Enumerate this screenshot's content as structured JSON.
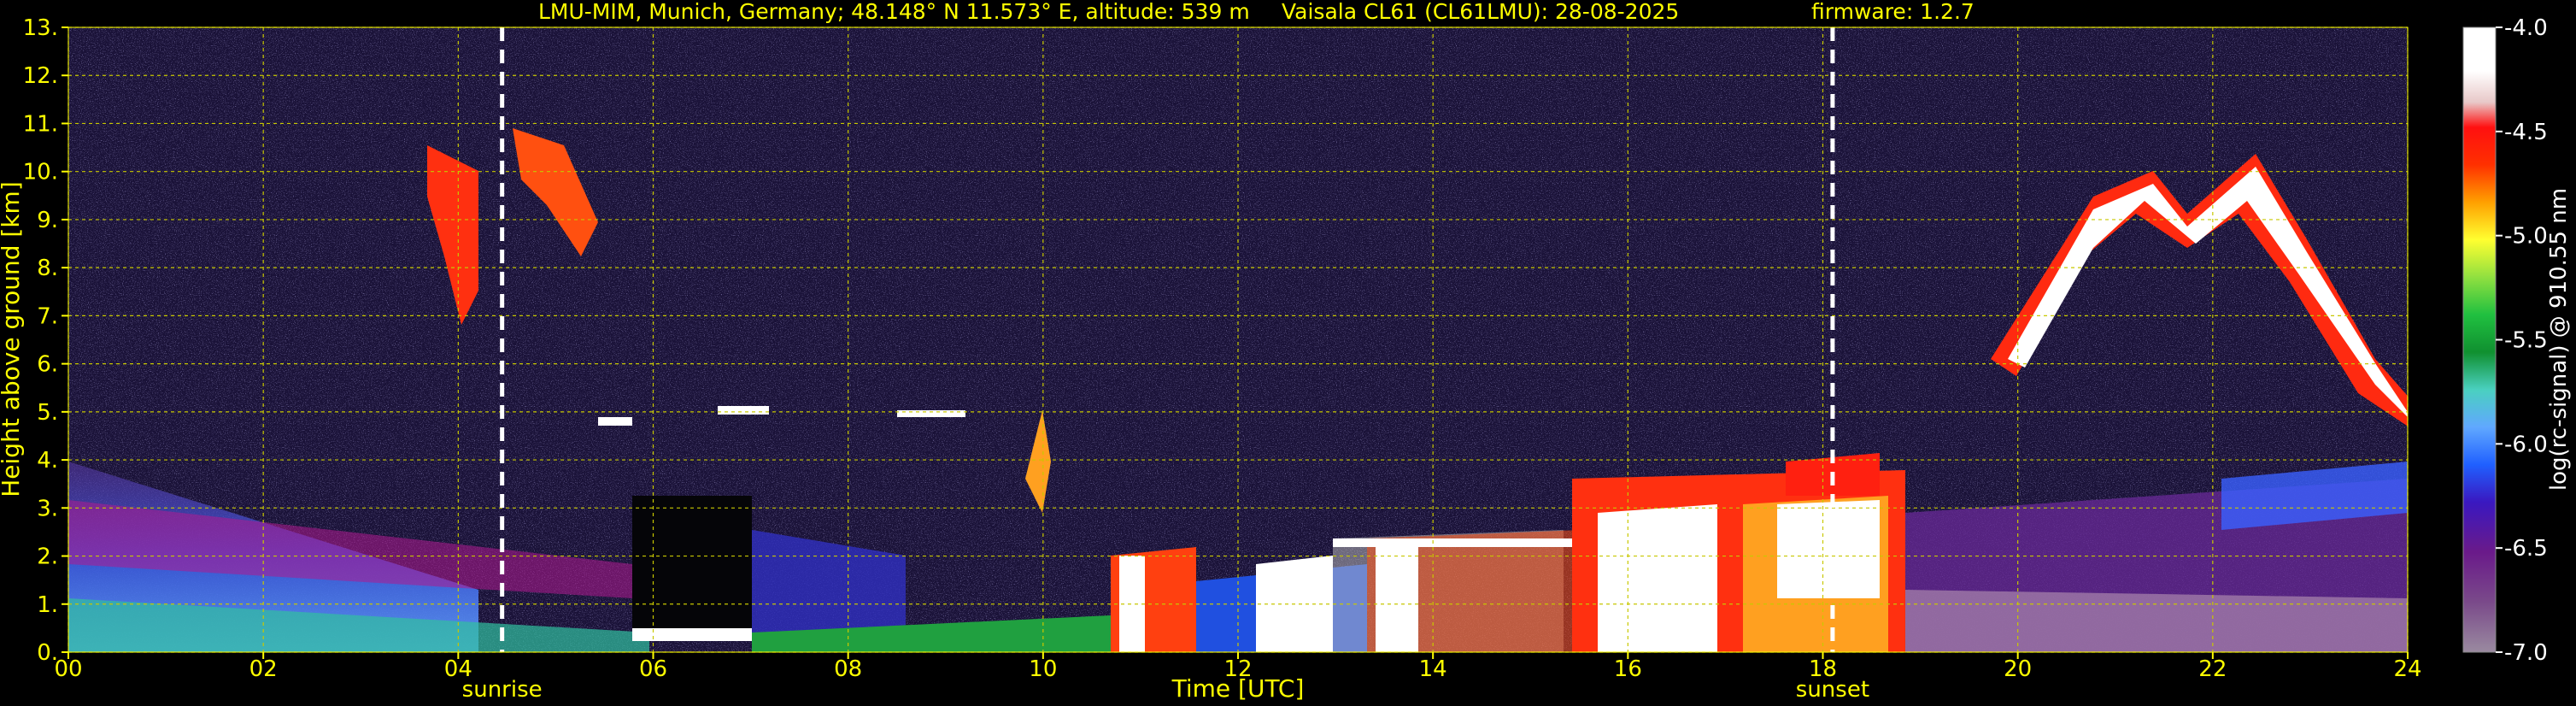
{
  "header": {
    "station": "LMU-MIM, Munich, Germany; 48.148° N 11.573° E, altitude: 539 m",
    "instrument": "Vaisala CL61 (CL61LMU): 28-08-2025",
    "firmware": "firmware: 1.2.7"
  },
  "chart_data": {
    "type": "heatmap",
    "xlabel": "Time [UTC]",
    "ylabel": "Height above ground [km]",
    "colorbar_label": "log(rc-signal) @ 910.55 nm",
    "xlim": [
      0,
      24
    ],
    "ylim": [
      0,
      13
    ],
    "x_ticks": [
      "00",
      "02",
      "04",
      "06",
      "08",
      "10",
      "12",
      "14",
      "16",
      "18",
      "20",
      "22",
      "24"
    ],
    "y_ticks": [
      "0.",
      "1.",
      "2.",
      "3.",
      "4.",
      "5.",
      "6.",
      "7.",
      "8.",
      "9.",
      "10.",
      "11.",
      "12.",
      "13."
    ],
    "colorbar_range": [
      -7.0,
      -4.0
    ],
    "colorbar_ticks": [
      "-4.0",
      "-4.5",
      "-5.0",
      "-5.5",
      "-6.0",
      "-6.5",
      "-7.0"
    ],
    "grid": true,
    "events": [
      {
        "label": "sunrise",
        "time": 4.45
      },
      {
        "label": "sunset",
        "time": 18.1
      }
    ]
  }
}
